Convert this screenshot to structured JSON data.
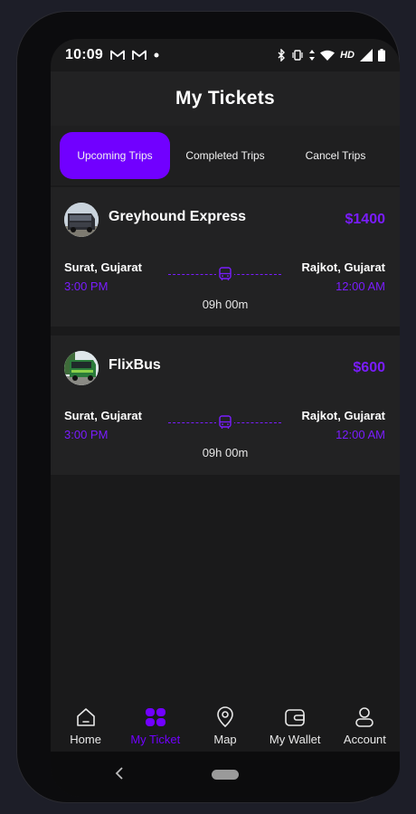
{
  "status_bar": {
    "time": "10:09",
    "hd": "HD"
  },
  "header": {
    "title": "My Tickets"
  },
  "tabs": [
    {
      "label": "Upcoming Trips",
      "active": true
    },
    {
      "label": "Completed Trips",
      "active": false
    },
    {
      "label": "Cancel Trips",
      "active": false
    }
  ],
  "tickets": [
    {
      "operator": "Greyhound Express",
      "price": "$1400",
      "from_city": "Surat, Gujarat",
      "from_time": "3:00 PM",
      "to_city": "Rajkot, Gujarat",
      "to_time": "12:00 AM",
      "duration": "09h 00m"
    },
    {
      "operator": "FlixBus",
      "price": "$600",
      "from_city": "Surat, Gujarat",
      "from_time": "3:00 PM",
      "to_city": "Rajkot, Gujarat",
      "to_time": "12:00 AM",
      "duration": "09h 00m"
    }
  ],
  "bottom_nav": [
    {
      "label": "Home",
      "icon": "home-icon",
      "active": false
    },
    {
      "label": "My Ticket",
      "icon": "ticket-icon",
      "active": true
    },
    {
      "label": "Map",
      "icon": "map-pin-icon",
      "active": false
    },
    {
      "label": "My Wallet",
      "icon": "wallet-icon",
      "active": false
    },
    {
      "label": "Account",
      "icon": "account-icon",
      "active": false
    }
  ],
  "colors": {
    "accent": "#7100ff",
    "price": "#7a1cff",
    "background": "#1a1a1b",
    "card": "#222223"
  }
}
